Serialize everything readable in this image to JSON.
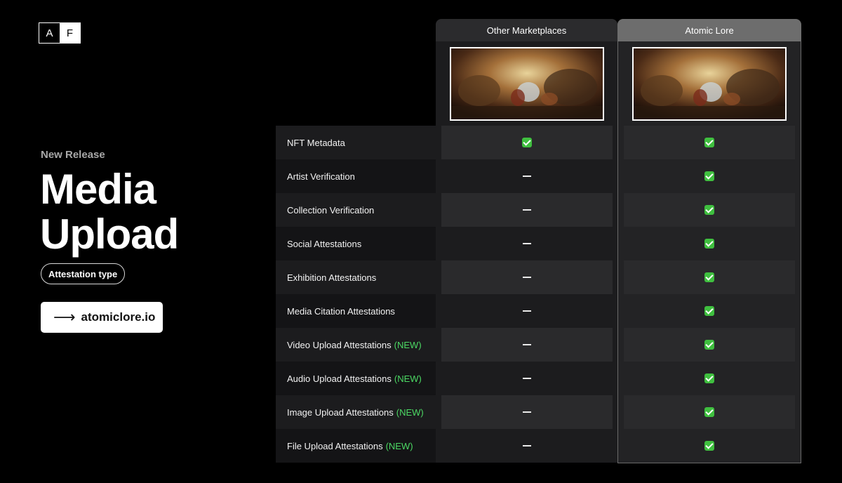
{
  "logo": {
    "letter1": "A",
    "letter2": "F"
  },
  "hero": {
    "subtitle": "New Release",
    "title_line1": "Media",
    "title_line2": "Upload",
    "pill": "Attestation type",
    "cta_label": "atomiclore.io"
  },
  "table": {
    "columns": [
      "Other Marketplaces",
      "Atomic Lore"
    ],
    "rows": [
      {
        "label": "NFT Metadata",
        "new": "",
        "other": "check",
        "atomic": "check"
      },
      {
        "label": "Artist Verification",
        "new": "",
        "other": "dash",
        "atomic": "check"
      },
      {
        "label": "Collection Verification",
        "new": "",
        "other": "dash",
        "atomic": "check"
      },
      {
        "label": "Social Attestations",
        "new": "",
        "other": "dash",
        "atomic": "check"
      },
      {
        "label": "Exhibition Attestations",
        "new": "",
        "other": "dash",
        "atomic": "check"
      },
      {
        "label": "Media Citation Attestations",
        "new": "",
        "other": "dash",
        "atomic": "check"
      },
      {
        "label": "Video Upload Attestations",
        "new": "(NEW)",
        "other": "dash",
        "atomic": "check"
      },
      {
        "label": "Audio Upload Attestations",
        "new": "(NEW)",
        "other": "dash",
        "atomic": "check"
      },
      {
        "label": "Image Upload Attestations",
        "new": "(NEW)",
        "other": "dash",
        "atomic": "check"
      },
      {
        "label": "File Upload Attestations",
        "new": "(NEW)",
        "other": "dash",
        "atomic": "check"
      }
    ]
  },
  "colors": {
    "accent_new": "#4cd964",
    "check": "#3fbf3f"
  }
}
